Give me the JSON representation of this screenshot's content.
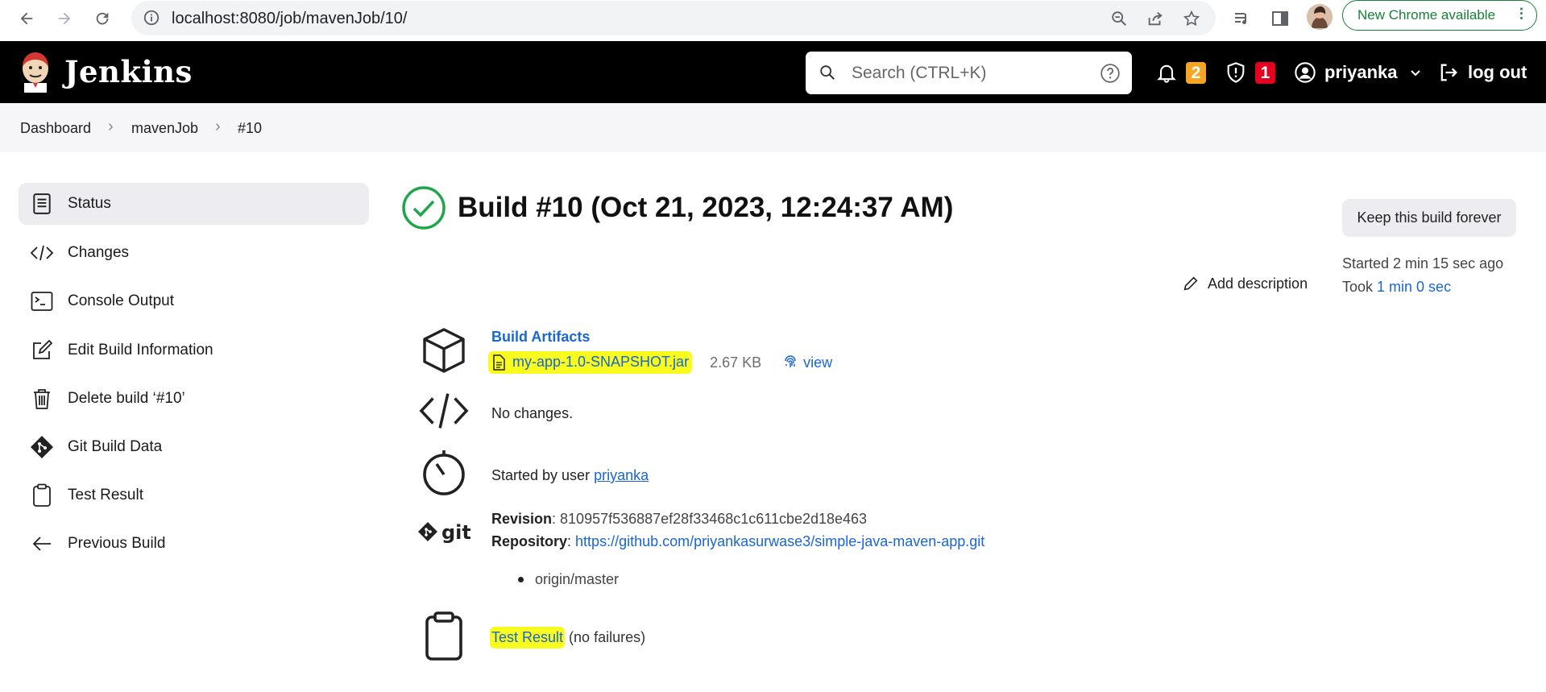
{
  "browser": {
    "url": "localhost:8080/job/mavenJob/10/",
    "update_label": "New Chrome available"
  },
  "header": {
    "app_name": "Jenkins",
    "search_placeholder": "Search (CTRL+K)",
    "notifications_count": "2",
    "security_count": "1",
    "user": "priyanka",
    "logout": "log out",
    "colors": {
      "notif_badge": "#f6a623",
      "security_badge": "#e6001f"
    }
  },
  "breadcrumb": [
    "Dashboard",
    "mavenJob",
    "#10"
  ],
  "sidebar": {
    "items": [
      {
        "label": "Status",
        "icon": "status-icon"
      },
      {
        "label": "Changes",
        "icon": "code-icon"
      },
      {
        "label": "Console Output",
        "icon": "terminal-icon"
      },
      {
        "label": "Edit Build Information",
        "icon": "edit-icon"
      },
      {
        "label": "Delete build ‘#10’",
        "icon": "trash-icon"
      },
      {
        "label": "Git Build Data",
        "icon": "git-icon"
      },
      {
        "label": "Test Result",
        "icon": "clipboard-icon"
      },
      {
        "label": "Previous Build",
        "icon": "arrow-left-icon"
      }
    ]
  },
  "main": {
    "title": "Build #10 (Oct 21, 2023, 12:24:37 AM)",
    "keep_forever": "Keep this build forever",
    "add_description": "Add description",
    "started": "Started 2 min 15 sec ago",
    "took_prefix": "Took ",
    "took_value": "1 min 0 sec",
    "artifacts_title": "Build Artifacts",
    "artifact_name": "my-app-1.0-SNAPSHOT.jar",
    "artifact_size": "2.67 KB",
    "artifact_view": "view",
    "no_changes": "No changes.",
    "started_by_prefix": "Started by user ",
    "started_by_user": "priyanka",
    "revision_label": "Revision",
    "revision_value": ": 810957f536887ef28f33468c1c611cbe2d18e463",
    "repo_label": "Repository",
    "repo_sep": ": ",
    "repo_url": "https://github.com/priyankasurwase3/simple-java-maven-app.git",
    "branch": "origin/master",
    "test_result_link": "Test Result",
    "test_result_note": " (no failures)"
  }
}
